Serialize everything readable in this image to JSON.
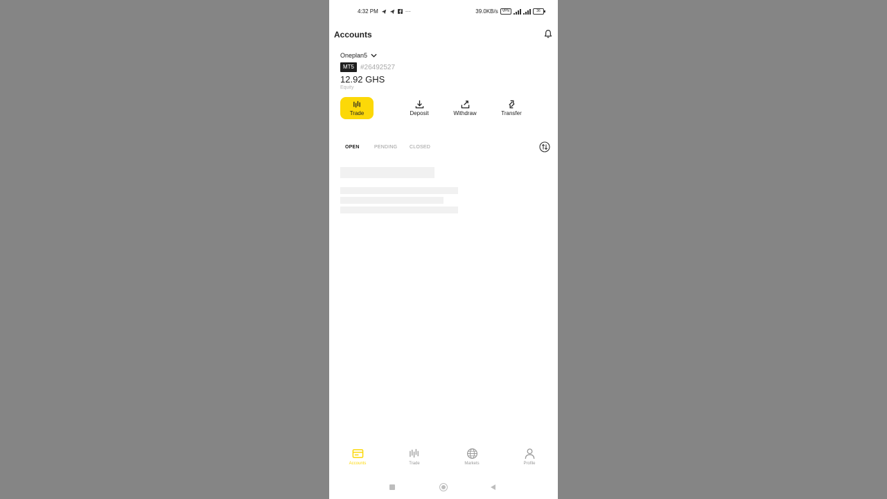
{
  "status_bar": {
    "time": "4:32 PM",
    "more": "···",
    "speed": "39.0KB/s",
    "vpn": "VPN",
    "battery": "36"
  },
  "header": {
    "title": "Accounts"
  },
  "account": {
    "name": "Oneplan5",
    "platform": "MT5",
    "number": "#26492527",
    "equity": "12.92 GHS",
    "equity_label": "Equity"
  },
  "actions": {
    "trade": "Trade",
    "deposit": "Deposit",
    "withdraw": "Withdraw",
    "transfer": "Transfer"
  },
  "tabs": {
    "open": "OPEN",
    "pending": "PENDING",
    "closed": "CLOSED"
  },
  "bottom_nav": {
    "accounts": "Accounts",
    "trade": "Trade",
    "markets": "Markets",
    "profile": "Profile"
  },
  "colors": {
    "accent": "#fcd808",
    "background": "#858585"
  }
}
